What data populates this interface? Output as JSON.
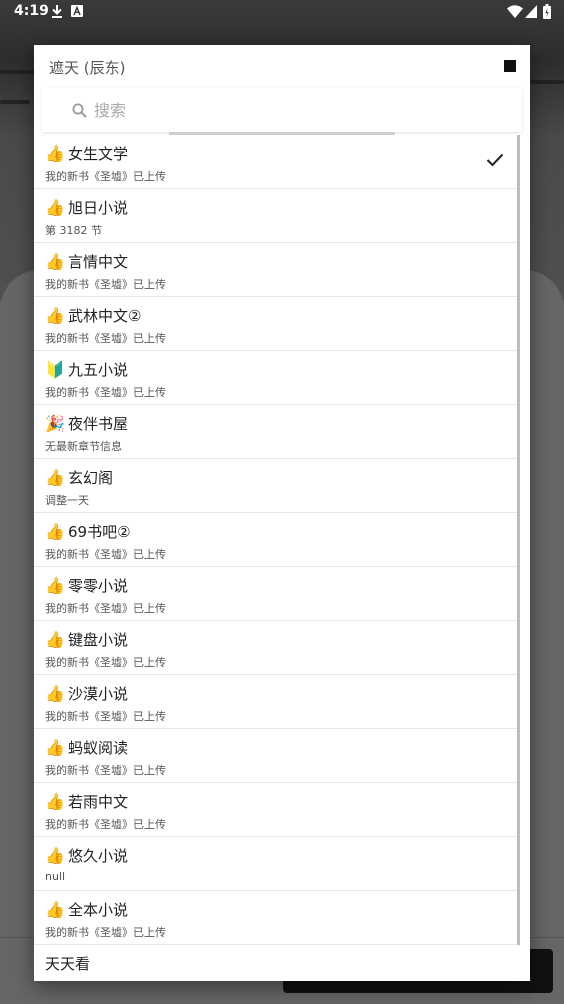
{
  "status_bar": {
    "time": "4:19",
    "icons": [
      "download-icon",
      "a-letter-icon",
      "wifi-icon",
      "signal-icon",
      "battery-icon"
    ]
  },
  "dialog": {
    "title": "遮天 (辰东)",
    "stop_icon": "stop-icon",
    "search": {
      "placeholder": "搜索",
      "value": ""
    }
  },
  "sources": [
    {
      "icon": "thumbs-up",
      "glyph": "👍",
      "name": "女生文学",
      "sub": "我的新书《圣墟》已上传",
      "selected": true
    },
    {
      "icon": "thumbs-up",
      "glyph": "👍",
      "name": "旭日小说",
      "sub": "第 3182 节",
      "selected": false
    },
    {
      "icon": "thumbs-up",
      "glyph": "👍",
      "name": "言情中文",
      "sub": "我的新书《圣墟》已上传",
      "selected": false
    },
    {
      "icon": "thumbs-up",
      "glyph": "👍",
      "name": "武林中文②",
      "sub": "我的新书《圣墟》已上传",
      "selected": false
    },
    {
      "icon": "beginner-badge",
      "glyph": "🔰",
      "name": "九五小说",
      "sub": "我的新书《圣墟》已上传",
      "selected": false
    },
    {
      "icon": "party-popper",
      "glyph": "🎉",
      "name": "夜伴书屋",
      "sub": "无最新章节信息",
      "selected": false
    },
    {
      "icon": "thumbs-up",
      "glyph": "👍",
      "name": "玄幻阁",
      "sub": "调整一天",
      "selected": false
    },
    {
      "icon": "thumbs-up",
      "glyph": "👍",
      "name": "69书吧②",
      "sub": "我的新书《圣墟》已上传",
      "selected": false
    },
    {
      "icon": "thumbs-up",
      "glyph": "👍",
      "name": "零零小说",
      "sub": "我的新书《圣墟》已上传",
      "selected": false
    },
    {
      "icon": "thumbs-up",
      "glyph": "👍",
      "name": "键盘小说",
      "sub": "我的新书《圣墟》已上传",
      "selected": false
    },
    {
      "icon": "thumbs-up",
      "glyph": "👍",
      "name": "沙漠小说",
      "sub": "我的新书《圣墟》已上传",
      "selected": false
    },
    {
      "icon": "thumbs-up",
      "glyph": "👍",
      "name": "蚂蚁阅读",
      "sub": "我的新书《圣墟》已上传",
      "selected": false
    },
    {
      "icon": "thumbs-up",
      "glyph": "👍",
      "name": "若雨中文",
      "sub": "我的新书《圣墟》已上传",
      "selected": false
    },
    {
      "icon": "thumbs-up",
      "glyph": "👍",
      "name": "悠久小说",
      "sub": "null",
      "selected": false
    },
    {
      "icon": "thumbs-up",
      "glyph": "👍",
      "name": "全本小说",
      "sub": "我的新书《圣墟》已上传",
      "selected": false
    }
  ],
  "last_item": "天天看"
}
